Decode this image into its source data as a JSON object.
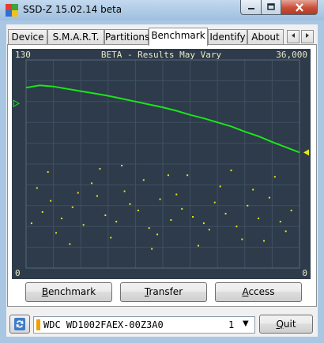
{
  "window": {
    "title": "SSD-Z 15.02.14 beta",
    "colors": {
      "frame": "#a9c7e3",
      "close": "#c74f3a"
    }
  },
  "tabs": [
    {
      "label": "Device",
      "active": false
    },
    {
      "label": "S.M.A.R.T.",
      "active": false
    },
    {
      "label": "Partitions",
      "active": false
    },
    {
      "label": "Benchmark",
      "active": true
    },
    {
      "label": "Identify",
      "active": false
    },
    {
      "label": "About",
      "active": false
    }
  ],
  "tab_scroll": {
    "left_icon": "arrow-left-icon",
    "right_icon": "arrow-right-icon"
  },
  "graph": {
    "banner": "BETA - Results May Vary",
    "y_top_left": "130",
    "y_top_right": "36,000",
    "y_bottom_left": "0",
    "y_bottom_right": "0",
    "colors": {
      "background": "#2e3b4a",
      "grid": "#3f5063",
      "transfer": "#19e619",
      "access": "#e6e61e"
    },
    "chart_data": {
      "type": "scatter",
      "series": [
        {
          "x": [
            0,
            5,
            10,
            15,
            20,
            25,
            30,
            35,
            40,
            45,
            50,
            55,
            60,
            65,
            70,
            75,
            80,
            85,
            90,
            95,
            100
          ],
          "y": [
            31200,
            31600,
            31400,
            31000,
            30600,
            30200,
            29800,
            29300,
            28800,
            28300,
            27800,
            27200,
            26500,
            25900,
            25200,
            24500,
            23600,
            22800,
            21800,
            20900,
            20000
          ]
        },
        {
          "x": [
            2,
            6,
            9,
            13,
            17,
            21,
            26,
            29,
            33,
            38,
            41,
            45,
            49,
            53,
            57,
            61,
            65,
            69,
            73,
            77,
            81,
            85,
            89,
            93,
            97,
            4,
            11,
            19,
            24,
            31,
            36,
            43,
            48,
            55,
            59,
            67,
            71,
            79,
            83,
            91,
            95,
            8,
            16,
            27,
            35,
            46,
            52,
            63,
            75,
            87
          ],
          "y": [
            28,
            35,
            42,
            31,
            38,
            27,
            45,
            33,
            29,
            40,
            36,
            25,
            43,
            30,
            37,
            32,
            28,
            41,
            34,
            26,
            39,
            31,
            44,
            29,
            36,
            50,
            22,
            47,
            53,
            19,
            48,
            55,
            21,
            46,
            58,
            24,
            51,
            18,
            49,
            57,
            23,
            60,
            15,
            62,
            64,
            12,
            58,
            14,
            61,
            17
          ]
        }
      ],
      "xlim": [
        0,
        100
      ],
      "ylim_left": [
        0,
        130
      ],
      "ylim_right": [
        0,
        36000
      ],
      "grid": true,
      "title": "BETA - Results May Vary"
    }
  },
  "buttons": {
    "benchmark": {
      "pre": "",
      "mnemonic": "B",
      "post": "enchmark"
    },
    "transfer": {
      "pre": "",
      "mnemonic": "T",
      "post": "ransfer"
    },
    "access": {
      "pre": "",
      "mnemonic": "A",
      "post": "ccess"
    }
  },
  "bottom": {
    "refresh_icon": "refresh-icon",
    "drive": "WDC WD1002FAEX-00Z3A0",
    "drive_number": "1",
    "quit": {
      "pre": "",
      "mnemonic": "Q",
      "post": "uit"
    }
  }
}
